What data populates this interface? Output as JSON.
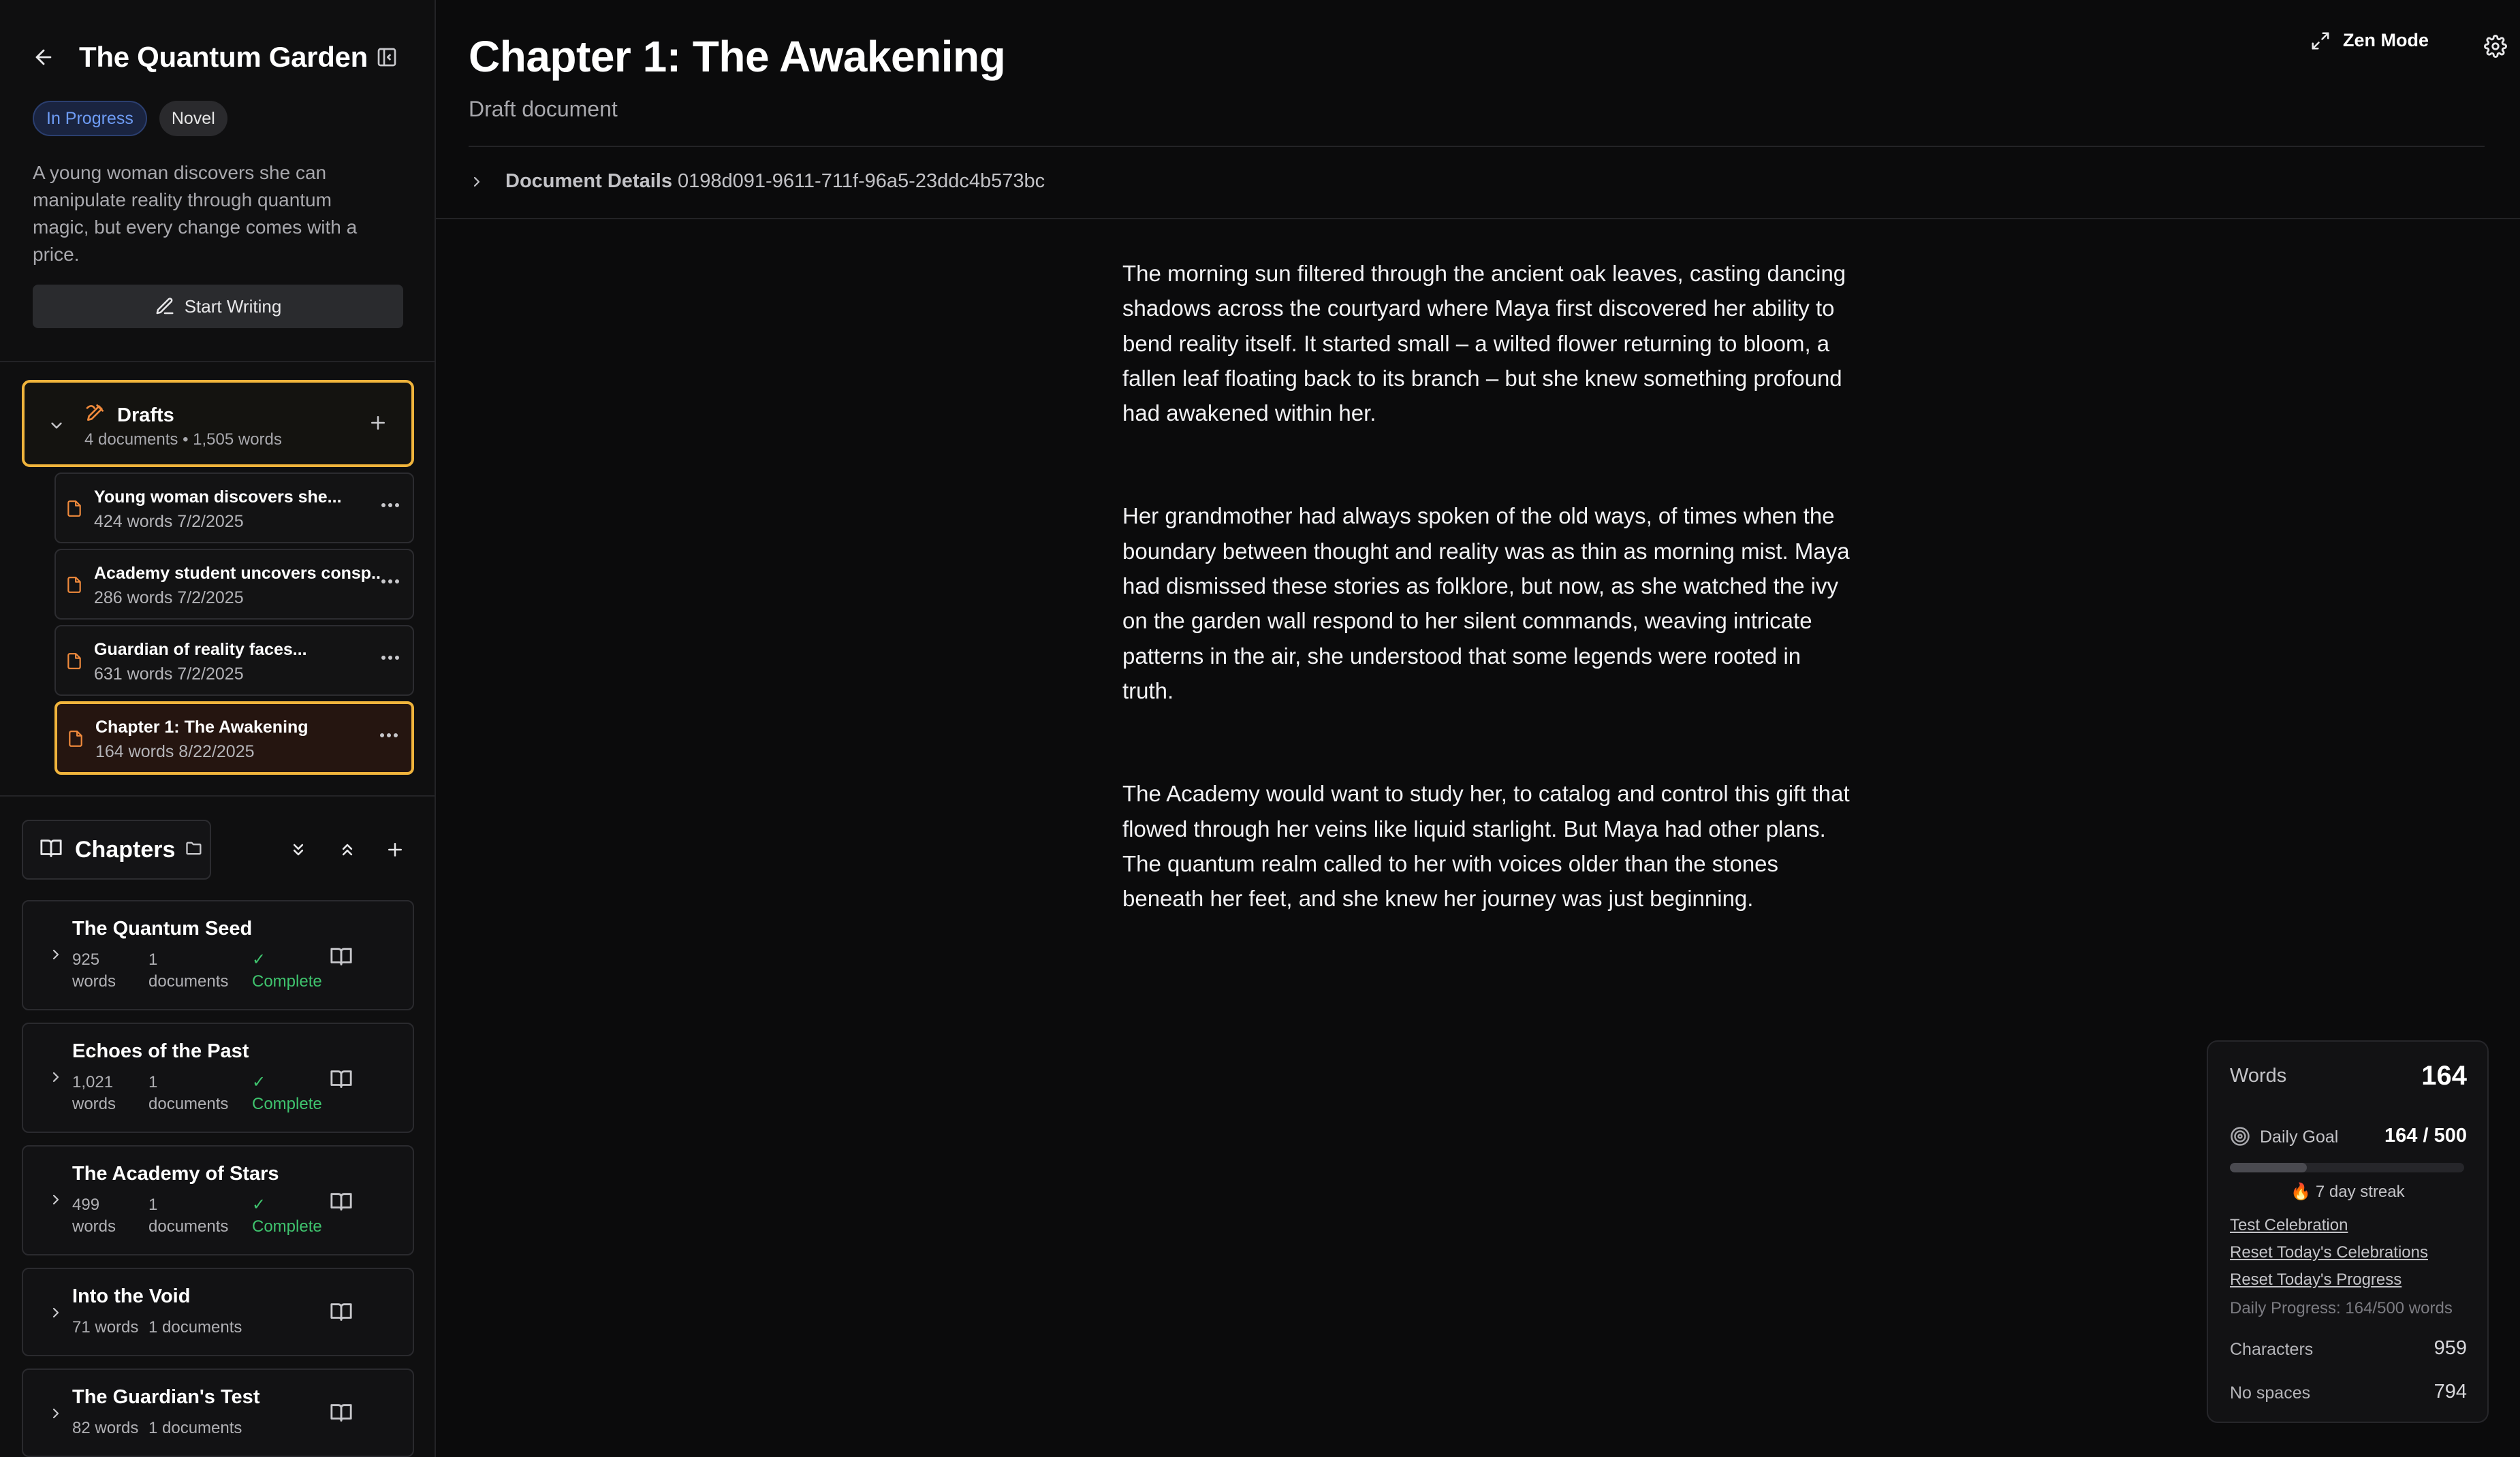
{
  "project": {
    "title": "The Quantum Garden",
    "status_badge": "In Progress",
    "genre_badge": "Novel",
    "description": "A young woman discovers she can manipulate reality through quantum magic, but every change comes with a price.",
    "start_writing_label": "Start Writing"
  },
  "drafts": {
    "title": "Drafts",
    "meta": "4 documents • 1,505 words",
    "items": [
      {
        "title": "Young woman discovers she...",
        "meta": "424 words  7/2/2025",
        "active": false
      },
      {
        "title": "Academy student uncovers consp...",
        "meta": "286 words  7/2/2025",
        "active": false
      },
      {
        "title": "Guardian of reality faces...",
        "meta": "631 words  7/2/2025",
        "active": false
      },
      {
        "title": "Chapter 1: The Awakening",
        "meta": "164 words  8/22/2025",
        "active": true
      }
    ]
  },
  "chapters": {
    "title": "Chapters",
    "items": [
      {
        "title": "The Quantum Seed",
        "words_num": "925",
        "words_unit": "words",
        "docs_num": "1",
        "docs_unit": "documents",
        "status": "Complete"
      },
      {
        "title": "Echoes of the Past",
        "words_num": "1,021",
        "words_unit": "words",
        "docs_num": "1",
        "docs_unit": "documents",
        "status": "Complete"
      },
      {
        "title": "The Academy of Stars",
        "words_num": "499",
        "words_unit": "words",
        "docs_num": "1",
        "docs_unit": "documents",
        "status": "Complete"
      },
      {
        "title": "Into the Void",
        "words": "71 words",
        "docs": "1 documents"
      },
      {
        "title": "The Guardian's Test",
        "words": "82 words",
        "docs": "1 documents"
      }
    ]
  },
  "document": {
    "title": "Chapter 1: The Awakening",
    "subtitle": "Draft document",
    "details_label": "Document Details",
    "details_id": "0198d091-9611-711f-96a5-23ddc4b573bc",
    "zen_mode_label": "Zen Mode",
    "paragraphs": [
      "The morning sun filtered through the ancient oak leaves, casting dancing shadows across the courtyard where Maya first discovered her ability to bend reality itself. It started small – a wilted flower returning to bloom, a fallen leaf floating back to its branch – but she knew something profound had awakened within her.",
      "Her grandmother had always spoken of the old ways, of times when the boundary between thought and reality was as thin as morning mist. Maya had dismissed these stories as folklore, but now, as she watched the ivy on the garden wall respond to her silent commands, weaving intricate patterns in the air, she understood that some legends were rooted in truth.",
      "The Academy would want to study her, to catalog and control this gift that flowed through her veins like liquid starlight. But Maya had other plans. The quantum realm called to her with voices older than the stones beneath her feet, and she knew her journey was just beginning."
    ]
  },
  "stats": {
    "words_label": "Words",
    "words_value": "164",
    "daily_goal_label": "Daily Goal",
    "daily_goal_value": "164 / 500",
    "goal_progress": 0.328,
    "streak": "🔥 7 day streak",
    "links": [
      "Test Celebration",
      "Reset Today's Celebrations",
      "Reset Today's Progress"
    ],
    "daily_progress": "Daily Progress: 164/500 words",
    "characters_label": "Characters",
    "characters_value": "959",
    "no_spaces_label": "No spaces",
    "no_spaces_value": "794"
  },
  "colors": {
    "accent_border": "#f0b43c",
    "status_complete": "#3fc46e",
    "badge_blue": "#6e9cf5"
  }
}
